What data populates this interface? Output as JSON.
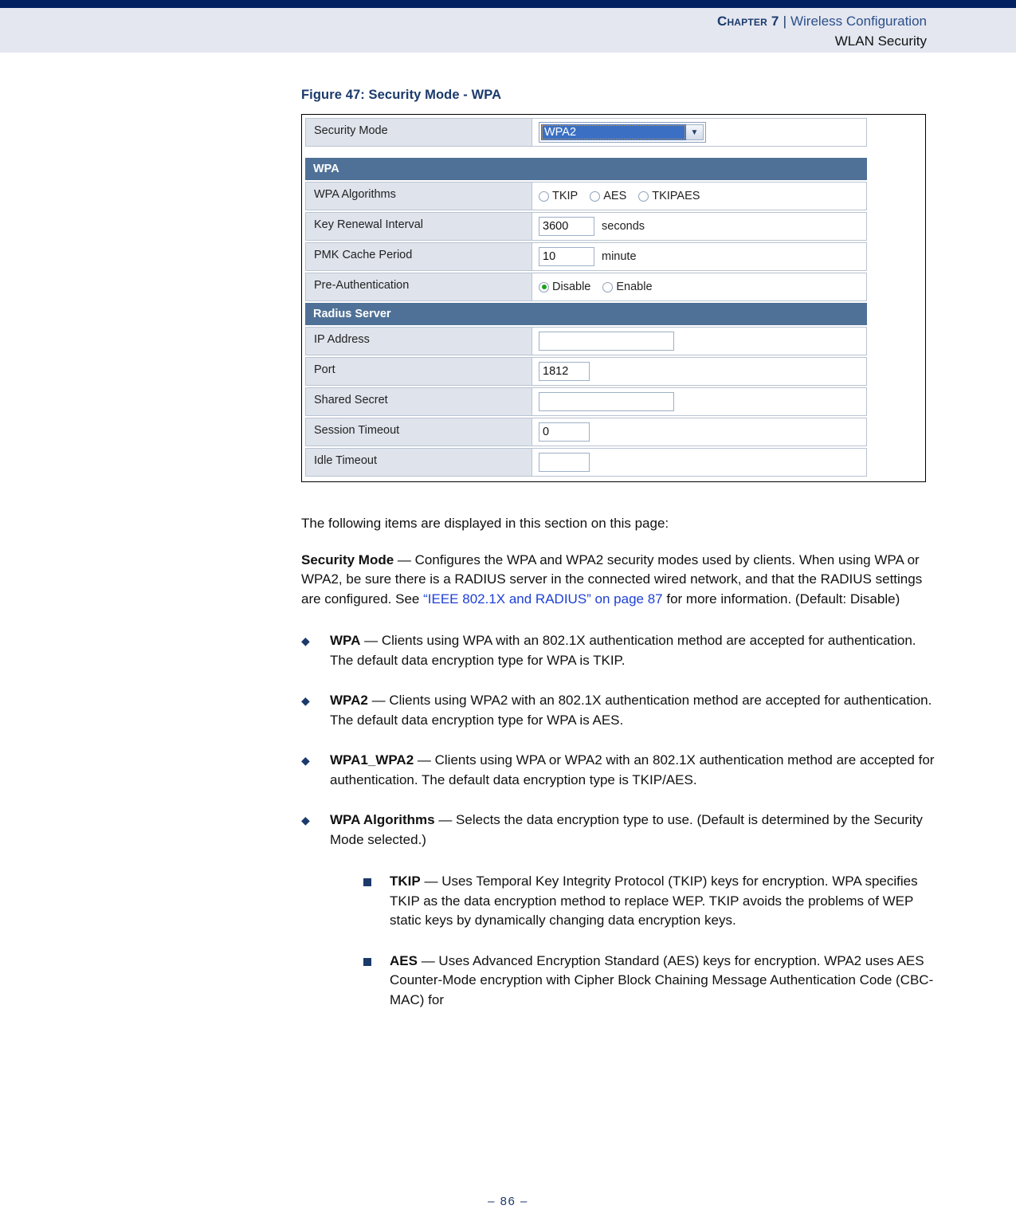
{
  "header": {
    "chapter": "Chapter 7",
    "separator": "|",
    "section": "Wireless Configuration",
    "subsection": "WLAN Security"
  },
  "figure": {
    "caption": "Figure 47:  Security Mode - WPA",
    "security_mode": {
      "label": "Security Mode",
      "selected": "WPA2",
      "arrow_icon": "chevron-down-icon"
    },
    "wpa_section": {
      "title": "WPA",
      "rows": [
        {
          "label": "WPA Algorithms",
          "type": "radio",
          "options": [
            {
              "label": "TKIP",
              "checked": false
            },
            {
              "label": "AES",
              "checked": false
            },
            {
              "label": "TKIPAES",
              "checked": false
            }
          ]
        },
        {
          "label": "Key Renewal Interval",
          "type": "text",
          "value": "3600",
          "unit": "seconds"
        },
        {
          "label": "PMK Cache Period",
          "type": "text",
          "value": "10",
          "unit": "minute"
        },
        {
          "label": "Pre-Authentication",
          "type": "radio",
          "options": [
            {
              "label": "Disable",
              "checked": true
            },
            {
              "label": "Enable",
              "checked": false
            }
          ]
        }
      ]
    },
    "radius_section": {
      "title": "Radius Server",
      "rows": [
        {
          "label": "IP Address",
          "type": "text",
          "value": "",
          "unit": ""
        },
        {
          "label": "Port",
          "type": "text",
          "value": "1812",
          "unit": ""
        },
        {
          "label": "Shared Secret",
          "type": "text",
          "value": "",
          "unit": ""
        },
        {
          "label": "Session Timeout",
          "type": "text",
          "value": "0",
          "unit": ""
        },
        {
          "label": "Idle Timeout",
          "type": "text",
          "value": "",
          "unit": ""
        }
      ]
    }
  },
  "body": {
    "intro": "The following items are displayed in this section on this page:",
    "security_mode": {
      "term": "Security Mode",
      "dash": " — ",
      "text_before_link": "Configures the WPA and WPA2 security modes used by clients. When using WPA or WPA2, be sure there is a RADIUS server in the connected wired network, and that the RADIUS settings are configured. See ",
      "link": "“IEEE 802.1X and RADIUS” on page 87",
      "text_after_link": " for more information. (Default: Disable)"
    },
    "bullets": [
      {
        "marker": "◆",
        "term": "WPA",
        "dash": " — ",
        "text": "Clients using WPA with an 802.1X authentication method are accepted for authentication. The default data encryption type for WPA is TKIP."
      },
      {
        "marker": "◆",
        "term": "WPA2",
        "dash": " — ",
        "text": "Clients using WPA2 with an 802.1X authentication method are accepted for authentication. The default data encryption type for WPA is AES."
      },
      {
        "marker": "◆",
        "term": "WPA1_WPA2",
        "dash": " — ",
        "text": "Clients using WPA or WPA2 with an 802.1X authentication method are accepted for authentication. The default data encryption type is TKIP/AES."
      },
      {
        "marker": "◆",
        "term": "WPA Algorithms",
        "dash": " — ",
        "text": "Selects the data encryption type to use. (Default is determined by the Security Mode selected.)"
      }
    ],
    "sub_bullets": [
      {
        "term": "TKIP",
        "dash": " — ",
        "text": "Uses Temporal Key Integrity Protocol (TKIP) keys for encryption. WPA specifies TKIP as the data encryption method to replace WEP. TKIP avoids the problems of WEP static keys by dynamically changing data encryption keys."
      },
      {
        "term": "AES",
        "dash": " — ",
        "text": "Uses Advanced Encryption Standard (AES) keys for encryption. WPA2 uses AES Counter-Mode encryption with Cipher Block Chaining Message Authentication Code (CBC-MAC) for"
      }
    ]
  },
  "footer": {
    "page_number": "–  86  –"
  },
  "colors": {
    "rule": "#002060",
    "header_band": "#e4e7f0",
    "chapter": "#1b3a6b",
    "link": "#1d3fd6",
    "section_bar": "#4f7197",
    "label_cell": "#dfe4ec",
    "select_highlight": "#3a6fc4",
    "radio_on": "#19a319"
  }
}
